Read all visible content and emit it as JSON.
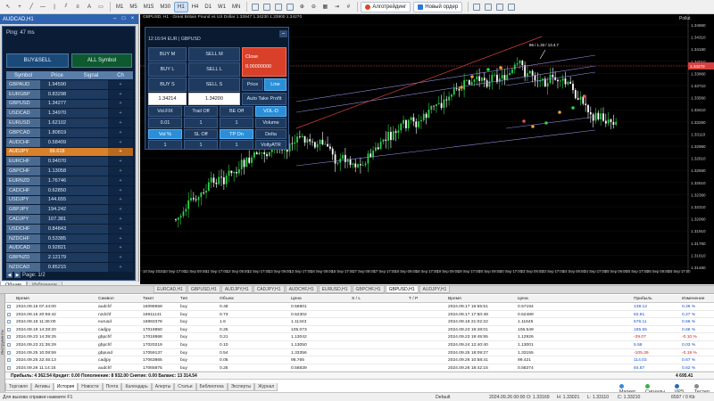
{
  "toolbar": {
    "timeframes": [
      "M1",
      "M5",
      "M15",
      "M30",
      "H1",
      "H4",
      "D1",
      "W1",
      "MN"
    ],
    "active_timeframe": "H1",
    "algo_label": "Алготрейдинг",
    "new_order_label": "Новый ордер"
  },
  "left_panel": {
    "title": "AUDCAD,H1",
    "ping": "Ping: 47 ms",
    "buysell_label": "BUY&SELL",
    "allsymbol_label": "ALL Symbol",
    "columns": [
      "Symbol",
      "Price",
      "Signal",
      "Ch"
    ],
    "rows": [
      {
        "symbol": "GBPAUD",
        "price": "1.94590",
        "ch": "+"
      },
      {
        "symbol": "EURGBP",
        "price": "0.83298",
        "ch": "+"
      },
      {
        "symbol": "GBPUSD",
        "price": "1.34277",
        "ch": "+"
      },
      {
        "symbol": "USDCAD",
        "price": "1.34970",
        "ch": "+"
      },
      {
        "symbol": "EURUSD",
        "price": "1.62102",
        "ch": "+"
      },
      {
        "symbol": "GBPCAD",
        "price": "1.80819",
        "ch": "+"
      },
      {
        "symbol": "AUDCHF",
        "price": "0.58409",
        "ch": "+"
      },
      {
        "symbol": "AUDJPY",
        "price": "99.618",
        "ch": "+"
      },
      {
        "symbol": "EURCHF",
        "price": "0.94070",
        "ch": "+"
      },
      {
        "symbol": "GBPCHF",
        "price": "1.13058",
        "ch": "+"
      },
      {
        "symbol": "EURNZD",
        "price": "1.76746",
        "ch": "+"
      },
      {
        "symbol": "CADCHF",
        "price": "0.62850",
        "ch": "+"
      },
      {
        "symbol": "USDJPY",
        "price": "144.655",
        "ch": "+"
      },
      {
        "symbol": "GBPJPY",
        "price": "194.242",
        "ch": "+"
      },
      {
        "symbol": "CADJPY",
        "price": "107.381",
        "ch": "+"
      },
      {
        "symbol": "USDCHF",
        "price": "0.84843",
        "ch": "+"
      },
      {
        "symbol": "NZDCHF",
        "price": "0.53385",
        "ch": "+"
      },
      {
        "symbol": "AUDCAD",
        "price": "0.92821",
        "ch": "+"
      },
      {
        "symbol": "GBPNZD",
        "price": "2.12179",
        "ch": "+"
      },
      {
        "symbol": "NZDCAD",
        "price": "0.85215",
        "ch": "+"
      }
    ],
    "selected_index": 7,
    "page_label": "Page: 1/2",
    "tabs": [
      "Общие",
      "Избранное"
    ]
  },
  "chart": {
    "title": "GBPUSD, H1 · Great Britain Pound vs US Dollar 1.33947 1.34230 1.33900 1.34270",
    "top_right_label": "Pollut",
    "annotation": "86 / 1.33 / 13.4.7",
    "price_labels": [
      "1.34660",
      "1.34310",
      "1.34160",
      "1.34010",
      "1.33860",
      "1.33710",
      "1.33560",
      "1.33410",
      "1.33260",
      "1.33110",
      "1.32960",
      "1.32810",
      "1.32660",
      "1.32510",
      "1.32360",
      "1.32210",
      "1.32060",
      "1.31910",
      "1.31760",
      "1.31610",
      "1.31460"
    ],
    "current_price": "1.34270",
    "time_labels": [
      "10 Sep 2024",
      "10 Sep 17:00",
      "11 Sep 09:00",
      "11 Sep 17:00",
      "12 Sep 09:00",
      "12 Sep 17:00",
      "13 Sep 09:00",
      "13 Sep 17:00",
      "16 Sep 09:00",
      "16 Sep 17:00",
      "17 Sep 09:00",
      "17 Sep 17:00",
      "18 Sep 09:00",
      "18 Sep 17:00",
      "19 Sep 09:00",
      "19 Sep 17:00",
      "20 Sep 09:00",
      "20 Sep 17:00",
      "23 Sep 09:00",
      "23 Sep 17:00",
      "24 Sep 09:00",
      "24 Sep 17:00",
      "25 Sep 09:00",
      "25 Sep 17:00",
      "26 Sep 09:00",
      "26 Sep 17:00"
    ],
    "tabs": [
      "EURCAD,H1",
      "GBPUSD,H1",
      "AUDJPY,H1",
      "CADJPY,H1",
      "AUDCHF,H1",
      "EURUSD,H1",
      "GBPCHF,H1",
      "GBPUSD,H1",
      "AUDJPY,H1"
    ],
    "active_tab_index": 7
  },
  "panel": {
    "header": "12:16:04 EUR | GBPUSD",
    "buy_m": "BUY M",
    "sell_m": "SELL M",
    "buy_l": "BUY L",
    "sell_l": "SELL L",
    "buy_s": "BUY S",
    "sell_s": "SELL S",
    "close_label": "Close",
    "close_value": "0.00000000",
    "bid": "1.34214",
    "ask": "1.34200",
    "price_btn": "Price",
    "line_btn": "Line",
    "auto_take": "Auto Take Profit",
    "vol_fix": "Vol.FIX",
    "trail_off": "Trail Off",
    "be_off": "BE Off",
    "vol_d": "VOL-D",
    "vol_val": "0.01",
    "n1": "1",
    "n2": "1",
    "volume": "Volume",
    "vol_pct": "Vol %",
    "sl_off": "SL Off",
    "tp_on": "TP On",
    "delta": "Delta",
    "n3": "1",
    "n4": "1",
    "n5": "1",
    "volty": "VoltyATR"
  },
  "terminal": {
    "side_label": "Инструменты",
    "columns": [
      "Время",
      "Символ",
      "Тикет",
      "Тип",
      "Объем",
      "Цена",
      "S / L",
      "T / P",
      "Время",
      "Цена",
      "Прибыль",
      "Изменение"
    ],
    "rows": [
      {
        "time": "2024.09.16 07:44:00",
        "symbol": "audchf",
        "ticket": "16098659",
        "type": "buy",
        "volume": "0.48",
        "price": "0.56901",
        "ctime": "2024.09.17 16:55:51",
        "cprice": "0.57194",
        "profit": "139.12",
        "change": "0.48 %"
      },
      {
        "time": "2024.09.16 20:59:42",
        "symbol": "nzdchf",
        "ticket": "16911141",
        "type": "buy",
        "volume": "0.73",
        "price": "0.52302",
        "ctime": "2024.09.17 17:50:48",
        "cprice": "0.52489",
        "profit": "82.81",
        "change": "0.27 %"
      },
      {
        "time": "2024.09.18 11:36:00",
        "symbol": "eurusd",
        "ticket": "16993378",
        "type": "buy",
        "volume": "1.6",
        "price": "1.11343",
        "ctime": "2024.09.18 21:02:22",
        "cprice": "1.11645",
        "profit": "576.11",
        "change": "0.66 %"
      },
      {
        "time": "2024.09.19 14:28:20",
        "symbol": "cadjpy",
        "ticket": "17019850",
        "type": "buy",
        "volume": "0.25",
        "price": "105.073",
        "ctime": "2024.09.23 19:48:01",
        "cprice": "106.549",
        "profit": "185.55",
        "change": "0.68 %"
      },
      {
        "time": "2024.09.23 14:39:25",
        "symbol": "gbpchf",
        "ticket": "17018868",
        "type": "buy",
        "volume": "0.21",
        "price": "1.13042",
        "ctime": "2024.09.23 19:45:55",
        "cprice": "1.12926",
        "profit": "-29.07",
        "change": "-0.10 %"
      },
      {
        "time": "2024.09.23 21:35:29",
        "symbol": "gbpchf",
        "ticket": "17020219",
        "type": "buy",
        "volume": "0.10",
        "price": "1.13050",
        "ctime": "2024.09.24 12:40:40",
        "cprice": "1.13001",
        "profit": "5.58",
        "change": "0.03 %"
      },
      {
        "time": "2024.09.25 10:08:59",
        "symbol": "gbpusd",
        "ticket": "17059137",
        "type": "buy",
        "volume": "0.54",
        "price": "1.33356",
        "ctime": "2024.09.25 18:09:27",
        "cprice": "1.33155",
        "profit": "-105.39",
        "change": "-0.19 %"
      },
      {
        "time": "2024.09.25 22:45:13",
        "symbol": "cadjpy",
        "ticket": "17063865",
        "type": "buy",
        "volume": "0.05",
        "price": "98.765",
        "ctime": "2024.09.26 10:58:41",
        "cprice": "99.421",
        "profit": "114.03",
        "change": "0.67 %"
      },
      {
        "time": "2024.09.26 11:14:15",
        "symbol": "audchf",
        "ticket": "17065875",
        "type": "buy",
        "volume": "0.25",
        "price": "0.56839",
        "ctime": "2024.09.26 18:42:15",
        "cprice": "0.58374",
        "profit": "84.87",
        "change": "0.62 %"
      }
    ],
    "summary": "Прибыль: 4 362.54  Кредит: 0.00  Пополнение: 8 932.00  Снятие: 0.00  Баланс: 13 314.54",
    "summary_value": "4 695.41",
    "tabs": [
      "Торговля",
      "Активы",
      "История",
      "Новости",
      "Почта",
      "Календарь",
      "Алерты",
      "Статьи",
      "Библиотека",
      "Эксперты",
      "Журнал"
    ],
    "active_tab_index": 2,
    "market_label": "Маркет",
    "signals_label": "Сигналы",
    "vps_label": "VPS",
    "tester_label": "Тестер"
  },
  "status": {
    "help": "Для вызова справки нажмите F1",
    "profile": "Default",
    "datetime": "2024.09.26 00:00",
    "o": "O: 1.33169",
    "h": "H: 1.33021",
    "l": "L: 1.33110",
    "c": "C: 1.33210",
    "net": "6597 / 0 Kb"
  },
  "colors": {
    "buy_panel": "#1e3a5e",
    "close_red": "#d8402a",
    "active_blue": "#2a8ed8",
    "selected_row": "#d8802a",
    "bull_candle": "#2ed34a",
    "bear_candle": "#ffffff",
    "channel_line": "#8a8ad8",
    "trend_red": "#d84040"
  }
}
